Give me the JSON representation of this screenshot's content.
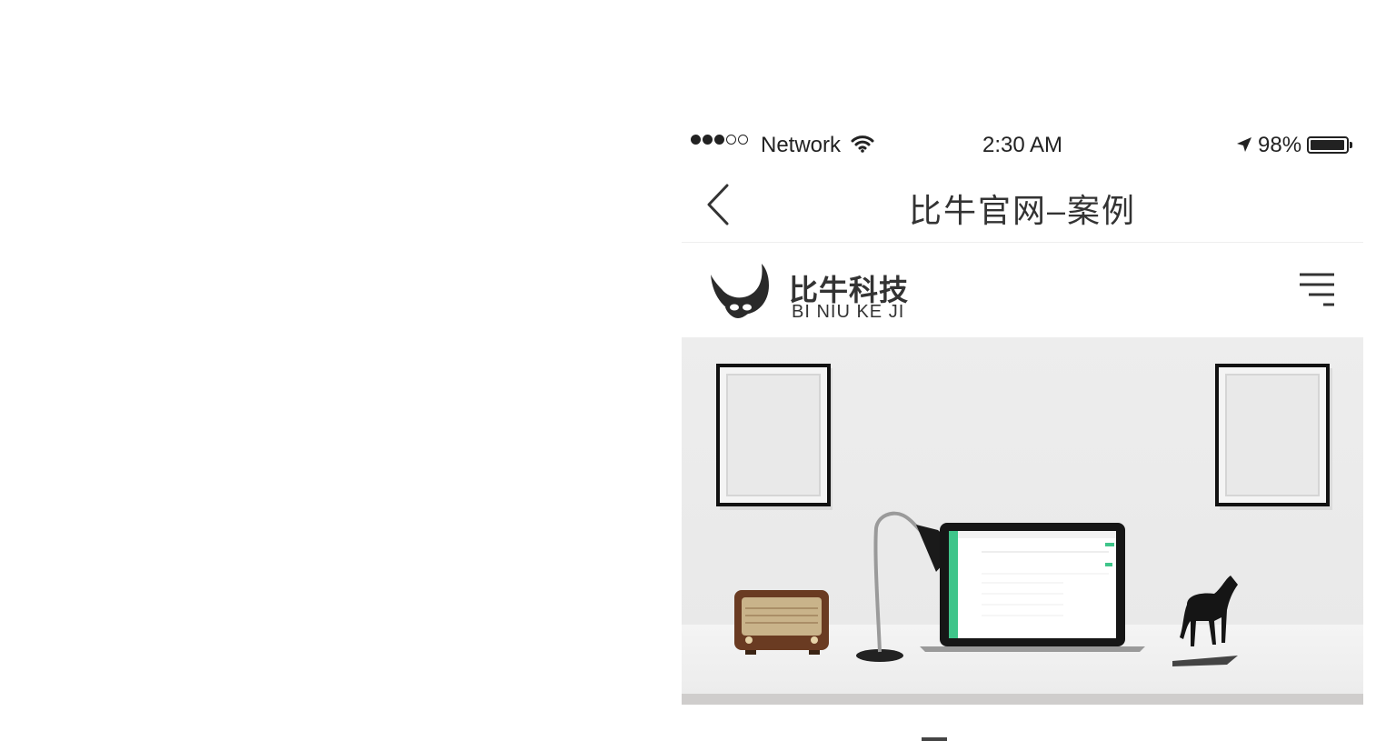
{
  "status_bar": {
    "carrier": "Network",
    "time": "2:30 AM",
    "battery": "98%",
    "battery_level": 0.98,
    "icons": [
      "signal-dots",
      "wifi-icon",
      "location-arrow-icon",
      "battery-icon"
    ]
  },
  "nav": {
    "back_icon": "chevron-left-icon",
    "title": "比牛官网–案例"
  },
  "site_header": {
    "brand_cn": "比牛科技",
    "brand_en": "BI NIU KE JI",
    "menu_icon": "menu-icon"
  },
  "hero": {
    "image": "office-desk-scene",
    "colors": {
      "accent": "#3fc58a",
      "wall": "#ededed"
    }
  }
}
